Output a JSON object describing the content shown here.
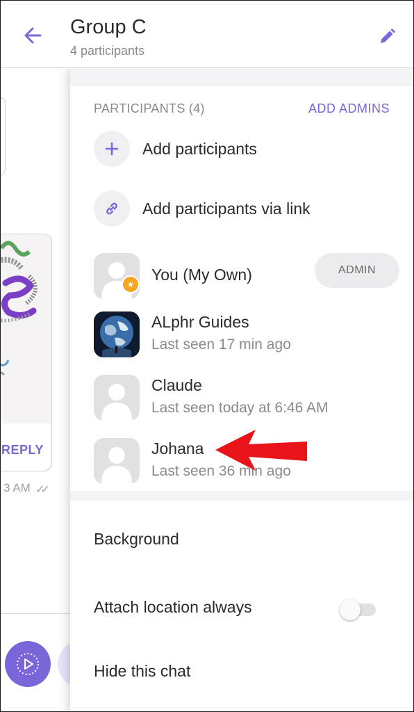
{
  "header": {
    "title": "Group C",
    "subtitle": "4 participants",
    "back_icon": "arrow-left-icon",
    "edit_icon": "pencil-icon"
  },
  "background_chat": {
    "reply_label": "REPLY",
    "time_partial": "3 AM",
    "ticks": "✓✓"
  },
  "participants": {
    "section_label": "PARTICIPANTS (4)",
    "add_admins_label": "ADD ADMINS",
    "actions": [
      {
        "label": "Add participants",
        "icon": "plus-icon"
      },
      {
        "label": "Add participants via link",
        "icon": "link-icon"
      }
    ],
    "members": [
      {
        "name": "You (My Own)",
        "status": "",
        "badge": "ADMIN",
        "avatar": "default-avatar"
      },
      {
        "name": "ALphr Guides",
        "status": "Last seen 17 min ago",
        "avatar": "earth-avatar"
      },
      {
        "name": "Claude",
        "status": "Last seen today at 6:46 AM",
        "avatar": "default-avatar"
      },
      {
        "name": "Johana",
        "status": "Last seen 36 min ago",
        "avatar": "default-avatar"
      }
    ]
  },
  "settings": {
    "background_label": "Background",
    "attach_location_label": "Attach location always",
    "attach_location_enabled": false,
    "hide_chat_label": "Hide this chat"
  },
  "colors": {
    "accent": "#7b66d9",
    "annotation_arrow": "#e8141a",
    "star_badge": "#f5a623"
  }
}
